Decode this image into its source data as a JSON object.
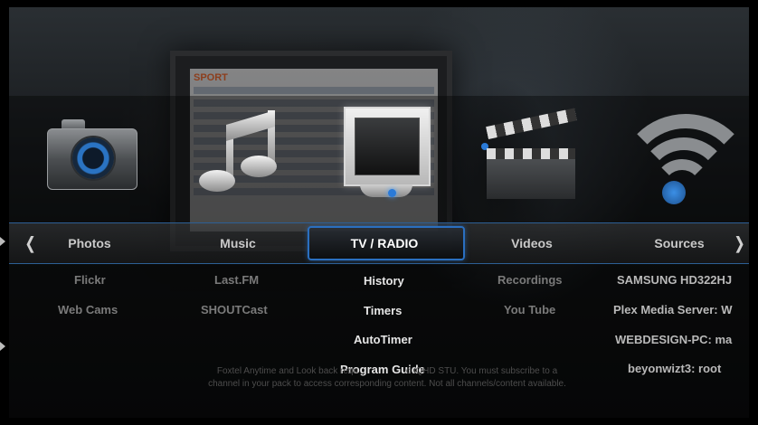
{
  "background": {
    "tv_screen_heading": "SPORT"
  },
  "icons": [
    {
      "name": "camera-icon"
    },
    {
      "name": "music-notes-icon"
    },
    {
      "name": "tv-icon"
    },
    {
      "name": "clapperboard-icon"
    },
    {
      "name": "wifi-icon"
    }
  ],
  "menu": {
    "left_arrow": "❬",
    "right_arrow": "❭",
    "items": [
      {
        "label": "Photos"
      },
      {
        "label": "Music"
      },
      {
        "label": "TV / RADIO"
      },
      {
        "label": "Videos"
      },
      {
        "label": "Sources"
      }
    ],
    "selected_index": 2
  },
  "submenu": {
    "photos": [
      "Flickr",
      "Web Cams"
    ],
    "music": [
      "Last.FM",
      "SHOUTCast"
    ],
    "tv": [
      "History",
      "Timers",
      "AutoTimer",
      "Program Guide"
    ],
    "videos": [
      "Recordings",
      "You Tube"
    ],
    "sources": [
      "SAMSUNG HD322HJ",
      "Plex Media Server: W",
      "WEBDESIGN-PC: ma",
      "beyonwizt3: root"
    ]
  },
  "notice": {
    "line1": "Foxtel Anytime and Look back requ                   d iQHD STU. You must subscribe to a",
    "line2": "channel in your pack to access corresponding content. Not all channels/content available."
  },
  "colors": {
    "accent": "#2a6fc0",
    "selected_text": "#ffffff",
    "menu_text": "#c9c9c9"
  }
}
